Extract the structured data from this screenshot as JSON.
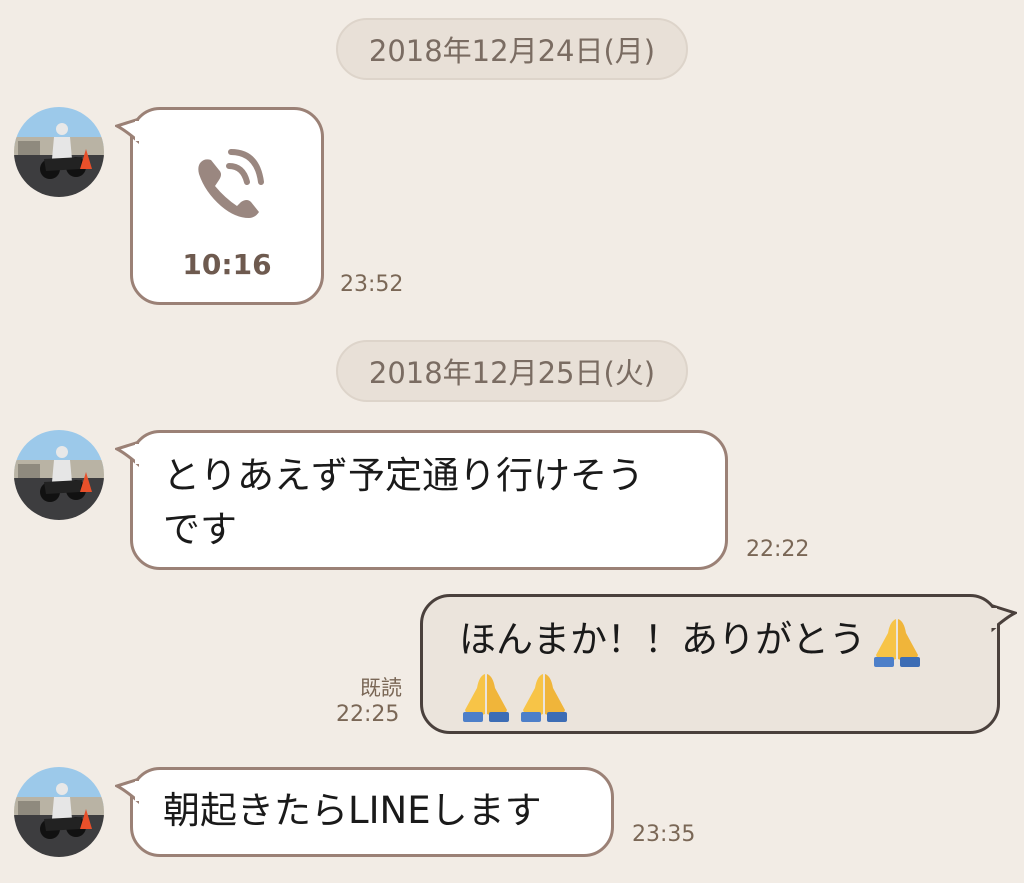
{
  "chat": {
    "date1": "2018年12月24日(月)",
    "date2": "2018年12月25日(火)",
    "call": {
      "duration": "10:16",
      "time": "23:52",
      "icon": "phone-call-icon"
    },
    "msg1": {
      "line1": "とりあえず予定通り行けそう",
      "line2": "です",
      "time": "22:22"
    },
    "msg2": {
      "line1": "ほんまか！！ありがとう",
      "line2_emoji": "🙏🙏",
      "read": "既読",
      "time": "22:25"
    },
    "msg3": {
      "text": "朝起きたらLINEします",
      "time": "23:35"
    }
  },
  "colors": {
    "background": "#f2ece5",
    "incoming_border": "#9b8176",
    "outgoing_bubble": "#ebe4dc",
    "outgoing_border": "#4a403c",
    "timestamp": "#7a6756"
  }
}
